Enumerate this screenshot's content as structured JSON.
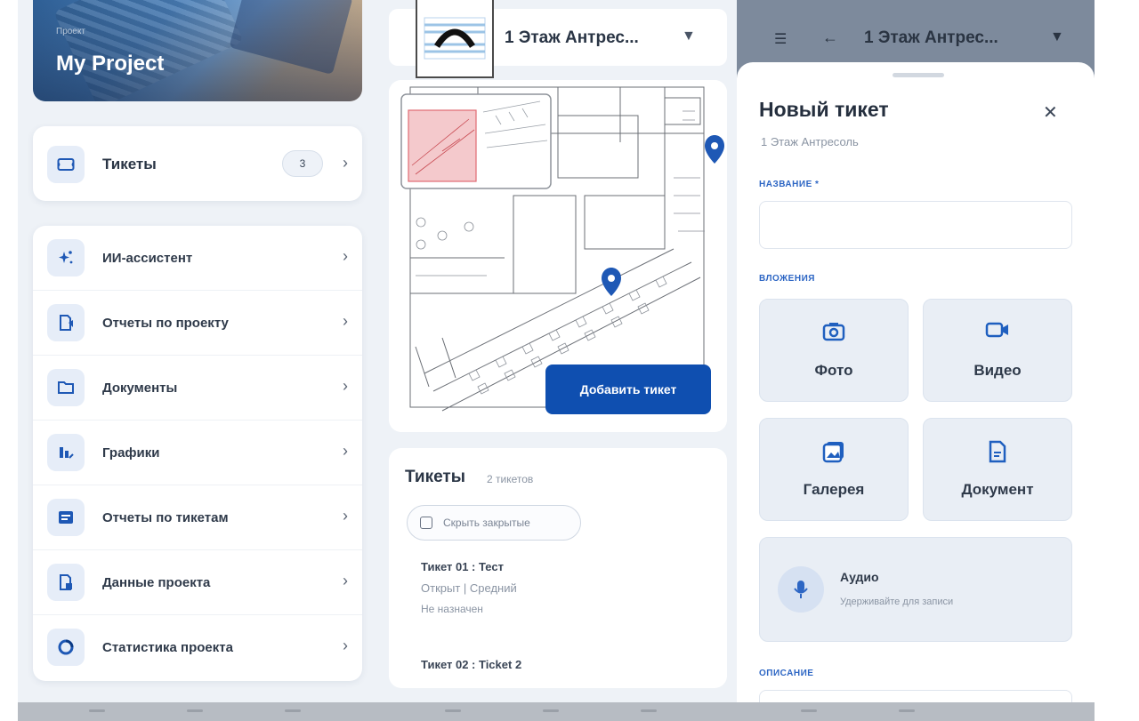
{
  "project": {
    "subtitle": "Проект",
    "name": "My Project"
  },
  "tickets_card": {
    "label": "Тикеты",
    "count": "3"
  },
  "menu": [
    {
      "label": "ИИ-ассистент",
      "icon": "sparkle-icon"
    },
    {
      "label": "Отчеты по проекту",
      "icon": "report-icon"
    },
    {
      "label": "Документы",
      "icon": "folder-icon"
    },
    {
      "label": "Графики",
      "icon": "chart-icon"
    },
    {
      "label": "Отчеты по тикетам",
      "icon": "ticket-report-icon"
    },
    {
      "label": "Данные проекта",
      "icon": "data-icon"
    },
    {
      "label": "Статистика проекта",
      "icon": "stats-icon"
    }
  ],
  "plan": {
    "title": "1 Этаж Антрес...",
    "add_ticket": "Добавить тикет"
  },
  "ticket_list": {
    "title": "Тикеты",
    "count": "2 тикетов",
    "hide_closed": "Скрыть закрытые",
    "items": [
      {
        "title": "Тикет 01 : Тест",
        "status": "Открыт | Средний",
        "assignee": "Не назначен"
      },
      {
        "title": "Тикет 02 : Ticket 2"
      }
    ]
  },
  "nav": {
    "title": "1 Этаж Антрес..."
  },
  "new_ticket": {
    "title": "Новый тикет",
    "subtitle": "1 Этаж Антресоль",
    "name_label": "НАЗВАНИЕ *",
    "attachments_label": "ВЛОЖЕНИЯ",
    "photo": "Фото",
    "video": "Видео",
    "gallery": "Галерея",
    "document": "Документ",
    "audio_title": "Аудио",
    "audio_hint": "Удерживайте для записи",
    "description_label": "ОПИСАНИЕ"
  },
  "colors": {
    "accent": "#0f4fb0",
    "pin": "#1e58b5",
    "highlight": "#f4c9cc"
  }
}
